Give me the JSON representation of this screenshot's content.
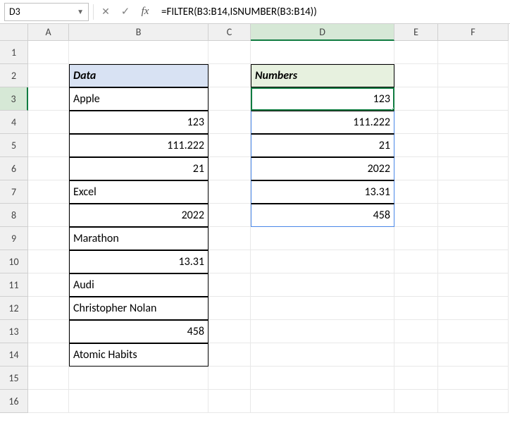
{
  "namebox": {
    "cell_ref": "D3"
  },
  "formula_bar": {
    "fx_label": "fx",
    "formula": "=FILTER(B3:B14,ISNUMBER(B3:B14))"
  },
  "columns": [
    "A",
    "B",
    "C",
    "D",
    "E",
    "F"
  ],
  "rows": [
    "1",
    "2",
    "3",
    "4",
    "5",
    "6",
    "7",
    "8",
    "9",
    "10",
    "11",
    "12",
    "13",
    "14",
    "15",
    "16"
  ],
  "active": {
    "col": "D",
    "row": "3"
  },
  "data_table": {
    "header": "Data",
    "items": [
      {
        "v": "Apple",
        "align": "txt"
      },
      {
        "v": "123",
        "align": "num"
      },
      {
        "v": "111.222",
        "align": "num"
      },
      {
        "v": "21",
        "align": "num"
      },
      {
        "v": "Excel",
        "align": "txt"
      },
      {
        "v": "2022",
        "align": "num"
      },
      {
        "v": "Marathon",
        "align": "txt"
      },
      {
        "v": "13.31",
        "align": "num"
      },
      {
        "v": "Audi",
        "align": "txt"
      },
      {
        "v": "Christopher Nolan",
        "align": "txt"
      },
      {
        "v": "458",
        "align": "num"
      },
      {
        "v": "Atomic Habits",
        "align": "txt"
      }
    ]
  },
  "numbers_table": {
    "header": "Numbers",
    "items": [
      "123",
      "111.222",
      "21",
      "2022",
      "13.31",
      "458"
    ]
  }
}
